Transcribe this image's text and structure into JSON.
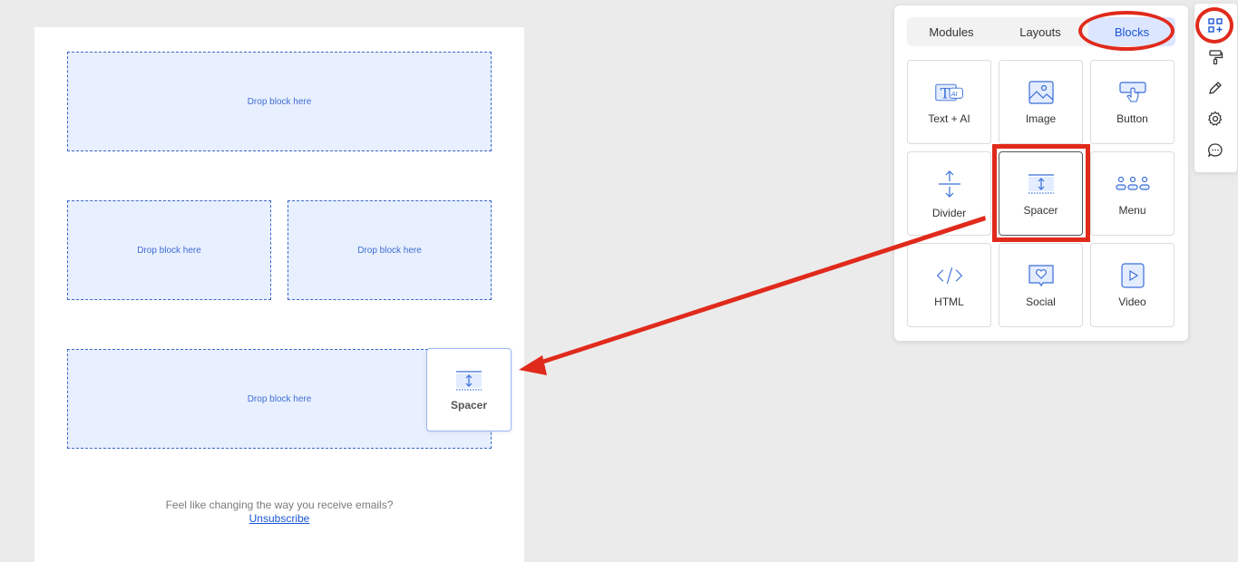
{
  "canvas": {
    "drop_label": "Drop block here",
    "footer_text": "Feel like changing the way you receive emails?",
    "unsubscribe": "Unsubscribe"
  },
  "drag_ghost": {
    "label": "Spacer",
    "icon": "spacer-icon"
  },
  "panel": {
    "tabs": [
      {
        "label": "Modules",
        "active": false
      },
      {
        "label": "Layouts",
        "active": false
      },
      {
        "label": "Blocks",
        "active": true
      }
    ],
    "blocks": [
      {
        "label": "Text + AI",
        "icon": "text-ai-icon"
      },
      {
        "label": "Image",
        "icon": "image-icon"
      },
      {
        "label": "Button",
        "icon": "button-icon"
      },
      {
        "label": "Divider",
        "icon": "divider-icon"
      },
      {
        "label": "Spacer",
        "icon": "spacer-icon",
        "selected": true
      },
      {
        "label": "Menu",
        "icon": "menu-icon"
      },
      {
        "label": "HTML",
        "icon": "html-icon"
      },
      {
        "label": "Social",
        "icon": "social-icon"
      },
      {
        "label": "Video",
        "icon": "video-icon"
      }
    ]
  },
  "rail": {
    "items": [
      "blocks-grid-icon",
      "paint-roller-icon",
      "pencil-icon",
      "gear-icon",
      "chat-icon"
    ]
  },
  "colors": {
    "accent": "#1a56d6",
    "highlight": "#e02a1b",
    "drop_fill": "#e8efff",
    "icon_blue": "#3a6fd8"
  }
}
